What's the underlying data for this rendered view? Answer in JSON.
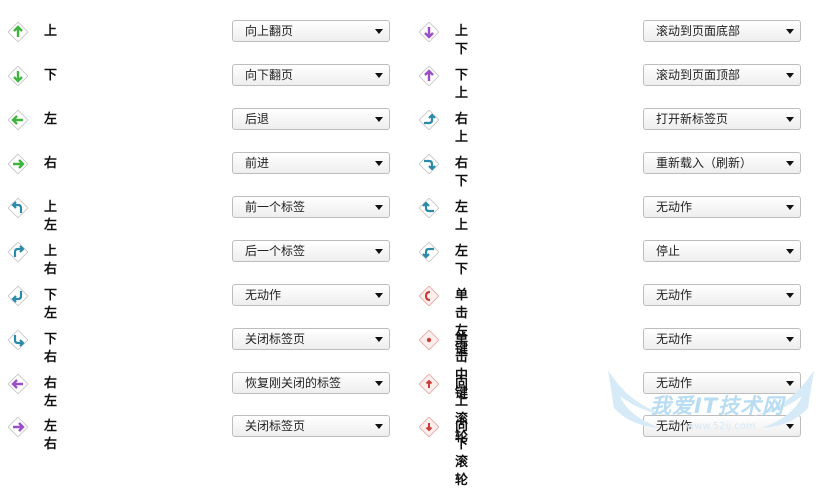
{
  "colors": {
    "green": "#3fb540",
    "purple": "#9b4fc7",
    "teal": "#2a8aa8",
    "red": "#c9403a",
    "border": "#bdbdbd"
  },
  "left": [
    {
      "label": "上",
      "value": "向上翻页",
      "icon": "arrow-up-icon",
      "color": "green"
    },
    {
      "label": "下",
      "value": "向下翻页",
      "icon": "arrow-down-icon",
      "color": "green"
    },
    {
      "label": "左",
      "value": "后退",
      "icon": "arrow-left-icon",
      "color": "green"
    },
    {
      "label": "右",
      "value": "前进",
      "icon": "arrow-right-icon",
      "color": "green"
    },
    {
      "label": "上左",
      "value": "前一个标签",
      "icon": "turn-up-left-icon",
      "color": "teal"
    },
    {
      "label": "上右",
      "value": "后一个标签",
      "icon": "turn-up-right-icon",
      "color": "teal"
    },
    {
      "label": "下左",
      "value": "无动作",
      "icon": "turn-down-left-icon",
      "color": "teal"
    },
    {
      "label": "下右",
      "value": "关闭标签页",
      "icon": "turn-down-right-icon",
      "color": "teal"
    },
    {
      "label": "右左",
      "value": "恢复刚关闭的标签",
      "icon": "right-left-icon",
      "color": "purple"
    },
    {
      "label": "左右",
      "value": "关闭标签页",
      "icon": "left-right-icon",
      "color": "purple"
    }
  ],
  "right": [
    {
      "label": "上下",
      "value": "滚动到页面底部",
      "icon": "up-down-icon",
      "color": "purple"
    },
    {
      "label": "下上",
      "value": "滚动到页面顶部",
      "icon": "down-up-icon",
      "color": "purple"
    },
    {
      "label": "右上",
      "value": "打开新标签页",
      "icon": "right-up-icon",
      "color": "teal"
    },
    {
      "label": "右下",
      "value": "重新载入（刷新）",
      "icon": "right-down-icon",
      "color": "teal"
    },
    {
      "label": "左上",
      "value": "无动作",
      "icon": "left-up-icon",
      "color": "teal"
    },
    {
      "label": "左下",
      "value": "停止",
      "icon": "left-down-icon",
      "color": "teal"
    },
    {
      "label": "单击左键",
      "value": "无动作",
      "icon": "left-click-icon",
      "color": "red"
    },
    {
      "label": "单击中键",
      "value": "无动作",
      "icon": "middle-click-icon",
      "color": "red"
    },
    {
      "label": "向上滚轮",
      "value": "无动作",
      "icon": "wheel-up-icon",
      "color": "red"
    },
    {
      "label": "向下滚轮",
      "value": "无动作",
      "icon": "wheel-down-icon",
      "color": "red"
    }
  ],
  "watermark": {
    "text": "我爱IT技术网",
    "url": "www.52ij.com"
  }
}
